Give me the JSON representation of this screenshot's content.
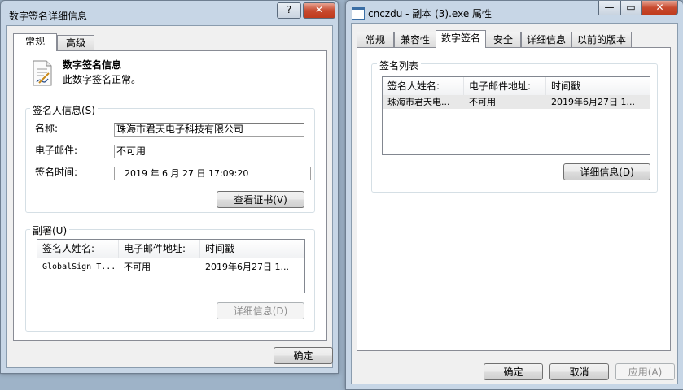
{
  "left_window": {
    "title": "数字签名详细信息",
    "help_btn": "?",
    "close_btn": "✕",
    "tabs": [
      {
        "label": "常规"
      },
      {
        "label": "高级"
      }
    ],
    "header": {
      "title": "数字签名信息",
      "status": "此数字签名正常。"
    },
    "signer_group": {
      "title": "签名人信息(S)",
      "name_label": "名称:",
      "name_value": "珠海市君天电子科技有限公司",
      "email_label": "电子邮件:",
      "email_value": "不可用",
      "time_label": "签名时间:",
      "time_value": "2019  年  6  月  27  日 17:09:20",
      "view_cert_btn": "查看证书(V)"
    },
    "countersign_group": {
      "title": "副署(U)",
      "columns": [
        "签名人姓名:",
        "电子邮件地址:",
        "时间戳"
      ],
      "rows": [
        [
          "GlobalSign T...",
          "不可用",
          "2019年6月27日 1..."
        ]
      ],
      "details_btn": "详细信息(D)"
    },
    "ok_btn": "确定"
  },
  "right_window": {
    "title": "cnczdu - 副本 (3).exe 属性",
    "min_btn": "—",
    "max_btn": "▭",
    "close_btn": "✕",
    "tabs": [
      {
        "label": "常规"
      },
      {
        "label": "兼容性"
      },
      {
        "label": "数字签名"
      },
      {
        "label": "安全"
      },
      {
        "label": "详细信息"
      },
      {
        "label": "以前的版本"
      }
    ],
    "sig_list_group": {
      "title": "签名列表",
      "columns": [
        "签名人姓名:",
        "电子邮件地址:",
        "时间戳"
      ],
      "rows": [
        [
          "珠海市君天电...",
          "不可用",
          "2019年6月27日 1..."
        ]
      ],
      "details_btn": "详细信息(D)"
    },
    "ok_btn": "确定",
    "cancel_btn": "取消",
    "apply_btn": "应用(A)"
  },
  "colors": {
    "desktop": "#9eb3c8",
    "frame": "#c7d6e6",
    "close_red": "#c74a2f"
  }
}
